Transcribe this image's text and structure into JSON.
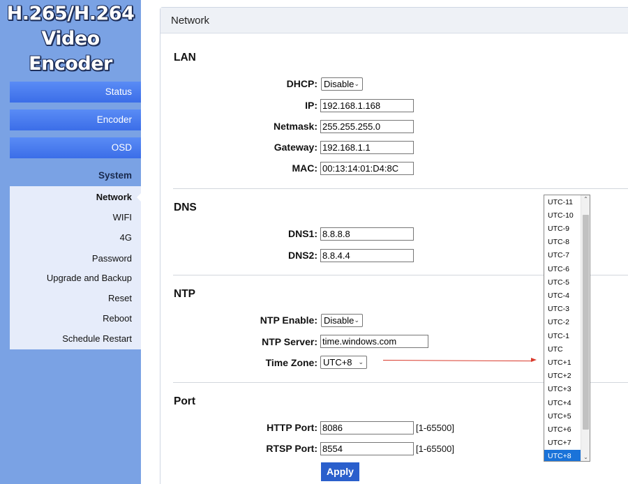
{
  "logo": {
    "line1": "H.265/H.264",
    "line2": "Video Encoder"
  },
  "nav": {
    "status": "Status",
    "encoder": "Encoder",
    "osd": "OSD",
    "system": "System",
    "submenu": [
      "Network",
      "WIFI",
      "4G",
      "Password",
      "Upgrade and Backup",
      "Reset",
      "Reboot",
      "Schedule Restart"
    ]
  },
  "panel": {
    "title": "Network"
  },
  "lan": {
    "title": "LAN",
    "dhcp_label": "DHCP:",
    "dhcp_value": "Disable",
    "ip_label": "IP:",
    "ip_value": "192.168.1.168",
    "netmask_label": "Netmask:",
    "netmask_value": "255.255.255.0",
    "gateway_label": "Gateway:",
    "gateway_value": "192.168.1.1",
    "mac_label": "MAC:",
    "mac_value": "00:13:14:01:D4:8C"
  },
  "dns": {
    "title": "DNS",
    "dns1_label": "DNS1:",
    "dns1_value": "8.8.8.8",
    "dns2_label": "DNS2:",
    "dns2_value": "8.8.4.4"
  },
  "ntp": {
    "title": "NTP",
    "enable_label": "NTP Enable:",
    "enable_value": "Disable",
    "server_label": "NTP Server:",
    "server_value": "time.windows.com",
    "tz_label": "Time Zone:",
    "tz_value": "UTC+8",
    "tz_options": [
      "UTC-11",
      "UTC-10",
      "UTC-9",
      "UTC-8",
      "UTC-7",
      "UTC-6",
      "UTC-5",
      "UTC-4",
      "UTC-3",
      "UTC-2",
      "UTC-1",
      "UTC",
      "UTC+1",
      "UTC+2",
      "UTC+3",
      "UTC+4",
      "UTC+5",
      "UTC+6",
      "UTC+7",
      "UTC+8"
    ],
    "tz_selected_index": 19
  },
  "port": {
    "title": "Port",
    "http_label": "HTTP Port:",
    "http_value": "8086",
    "http_range": "[1-65500]",
    "rtsp_label": "RTSP Port:",
    "rtsp_value": "8554",
    "rtsp_range": "[1-65500]"
  },
  "apply_label": "Apply",
  "colors": {
    "sidebar": "#7aa2e4",
    "nav_button": "#3b6ee8",
    "apply": "#2a5fcc",
    "selected_option": "#1a73d9",
    "annotation": "#d9392b"
  }
}
